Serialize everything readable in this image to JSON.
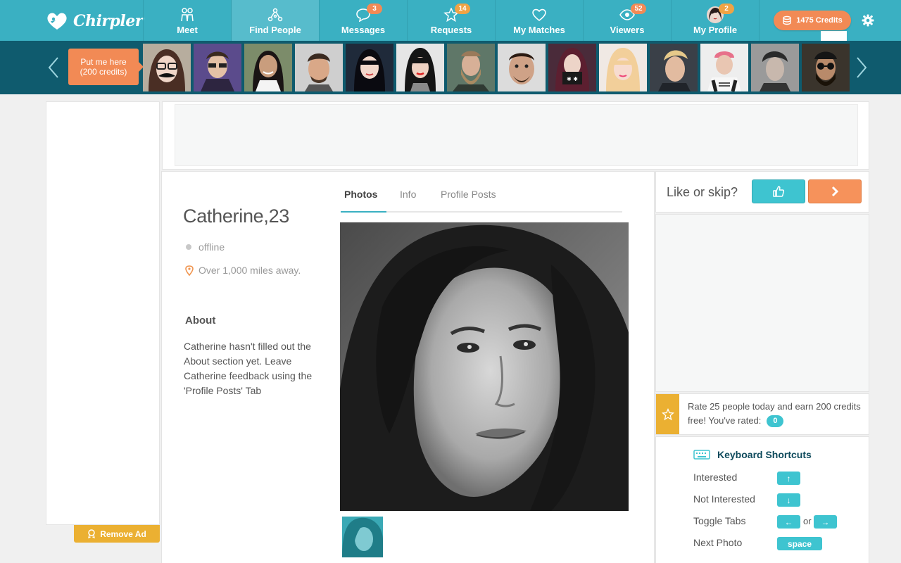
{
  "app": {
    "name": "Chirpler"
  },
  "nav": {
    "tabs": [
      {
        "label": "Meet",
        "icon": "people-icon",
        "badge": ""
      },
      {
        "label": "Find People",
        "icon": "network-icon",
        "badge": "",
        "active": true
      },
      {
        "label": "Messages",
        "icon": "chat-bubble-icon",
        "badge": "3"
      },
      {
        "label": "Requests",
        "icon": "star-icon",
        "badge": "14"
      },
      {
        "label": "My Matches",
        "icon": "heart-icon",
        "badge": ""
      },
      {
        "label": "Viewers",
        "icon": "eye-icon",
        "badge": "52"
      },
      {
        "label": "My Profile",
        "icon": "avatar",
        "badge": "2"
      }
    ],
    "credits_label": "1475 Credits"
  },
  "strip": {
    "promo_line1": "Put me here",
    "promo_line2": "(200 credits)",
    "thumbnail_count": 14
  },
  "profile": {
    "name": "Catherine,23",
    "status": "offline",
    "distance": "Over 1,000 miles away.",
    "about_title": "About",
    "about_text": "Catherine hasn't filled out the About section yet. Leave Catherine feedback using the 'Profile Posts' Tab",
    "tabs": [
      "Photos",
      "Info",
      "Profile Posts"
    ],
    "active_tab": "Photos"
  },
  "like_panel": {
    "prompt": "Like or skip?"
  },
  "remove_ad": {
    "label": "Remove Ad"
  },
  "rate": {
    "text": "Rate 25 people today and earn 200 credits free! You've rated:",
    "count": "0"
  },
  "shortcuts": {
    "title": "Keyboard Shortcuts",
    "rows": [
      {
        "label": "Interested",
        "keys": [
          "↑"
        ]
      },
      {
        "label": "Not Interested",
        "keys": [
          "↓"
        ]
      },
      {
        "label": "Toggle Tabs",
        "keys": [
          "←",
          "→"
        ],
        "joiner": "or"
      },
      {
        "label": "Next Photo",
        "keys": [
          "space"
        ]
      }
    ]
  },
  "colors": {
    "nav_bg": "#3ab0c2",
    "strip_bg": "#0f5b6e",
    "accent_orange": "#f28a55",
    "accent_teal": "#3ec4d0",
    "badge_yellow": "#ebb032"
  }
}
